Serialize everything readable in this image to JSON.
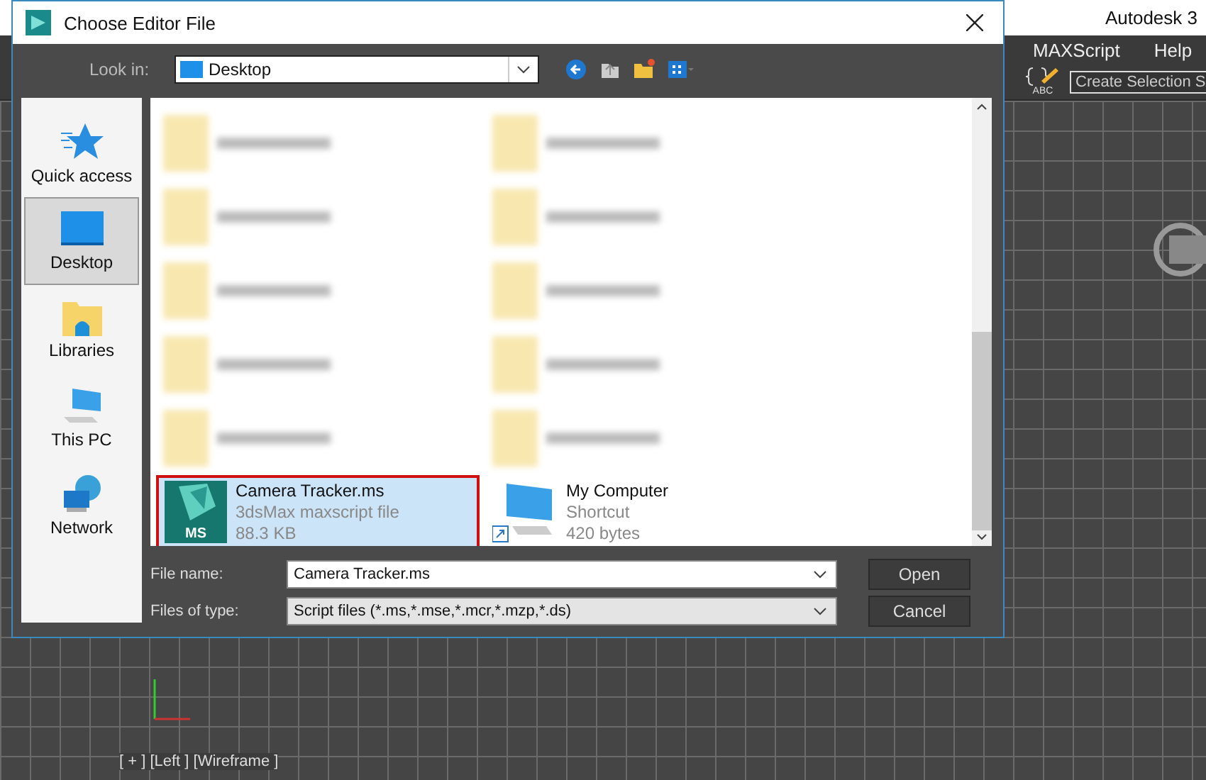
{
  "app": {
    "title": "Autodesk 3",
    "menu": [
      "MAXScript",
      "Help"
    ],
    "icon_caption": "ABC",
    "selection_field": {
      "placeholder": "Create Selection S"
    },
    "viewport_label": "[ + ] [Left ] [Wireframe ]"
  },
  "dialog": {
    "title": "Choose Editor File",
    "look_in": {
      "label": "Look in:",
      "value": "Desktop"
    },
    "places": [
      {
        "label": "Quick access",
        "selected": false
      },
      {
        "label": "Desktop",
        "selected": true
      },
      {
        "label": "Libraries",
        "selected": false
      },
      {
        "label": "This PC",
        "selected": false
      },
      {
        "label": "Network",
        "selected": false
      }
    ],
    "files": [
      {
        "kind": "blurred"
      },
      {
        "kind": "blurred"
      },
      {
        "kind": "blurred"
      },
      {
        "kind": "blurred"
      },
      {
        "kind": "blurred"
      },
      {
        "kind": "blurred"
      },
      {
        "kind": "blurred"
      },
      {
        "kind": "blurred"
      },
      {
        "kind": "blurred"
      },
      {
        "kind": "blurred"
      },
      {
        "kind": "script",
        "badge": "MS",
        "name": "Camera Tracker.ms",
        "type": "3dsMax maxscript file",
        "size": "88.3 KB",
        "selected": true
      },
      {
        "kind": "shortcut",
        "name": "My Computer",
        "type": "Shortcut",
        "size": "420 bytes",
        "selected": false
      }
    ],
    "file_name": {
      "label": "File name:",
      "value": "Camera Tracker.ms"
    },
    "file_type": {
      "label": "Files of type:",
      "value": "Script files (*.ms,*.mse,*.mcr,*.mzp,*.ds)"
    },
    "buttons": [
      "Open",
      "Cancel"
    ]
  }
}
